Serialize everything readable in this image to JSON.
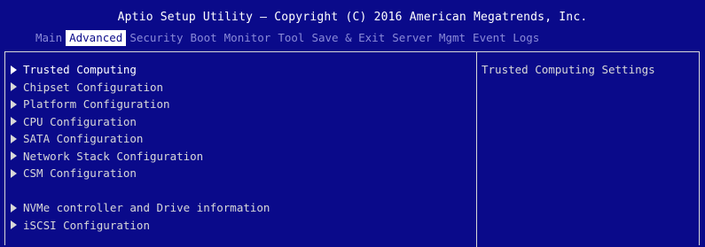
{
  "header": {
    "title": "Aptio Setup Utility – Copyright (C) 2016 American Megatrends, Inc.",
    "tabs": [
      "Main",
      "Advanced",
      "Security",
      "Boot",
      "Monitor",
      "Tool",
      "Save & Exit",
      "Server Mgmt",
      "Event Logs"
    ],
    "active_tab": "Advanced"
  },
  "menu": {
    "items": [
      "Trusted Computing",
      "Chipset Configuration",
      "Platform Configuration",
      "CPU Configuration",
      "SATA Configuration",
      "Network Stack Configuration",
      "CSM Configuration",
      "NVMe controller and Drive information",
      "iSCSI Configuration"
    ],
    "selected": "Trusted Computing"
  },
  "help": {
    "text": "Trusted Computing Settings"
  },
  "colors": {
    "background": "#0a0a8a",
    "text": "#d8d8d8",
    "highlight": "#ffffff",
    "inactive_tab": "#8a8ad8"
  }
}
